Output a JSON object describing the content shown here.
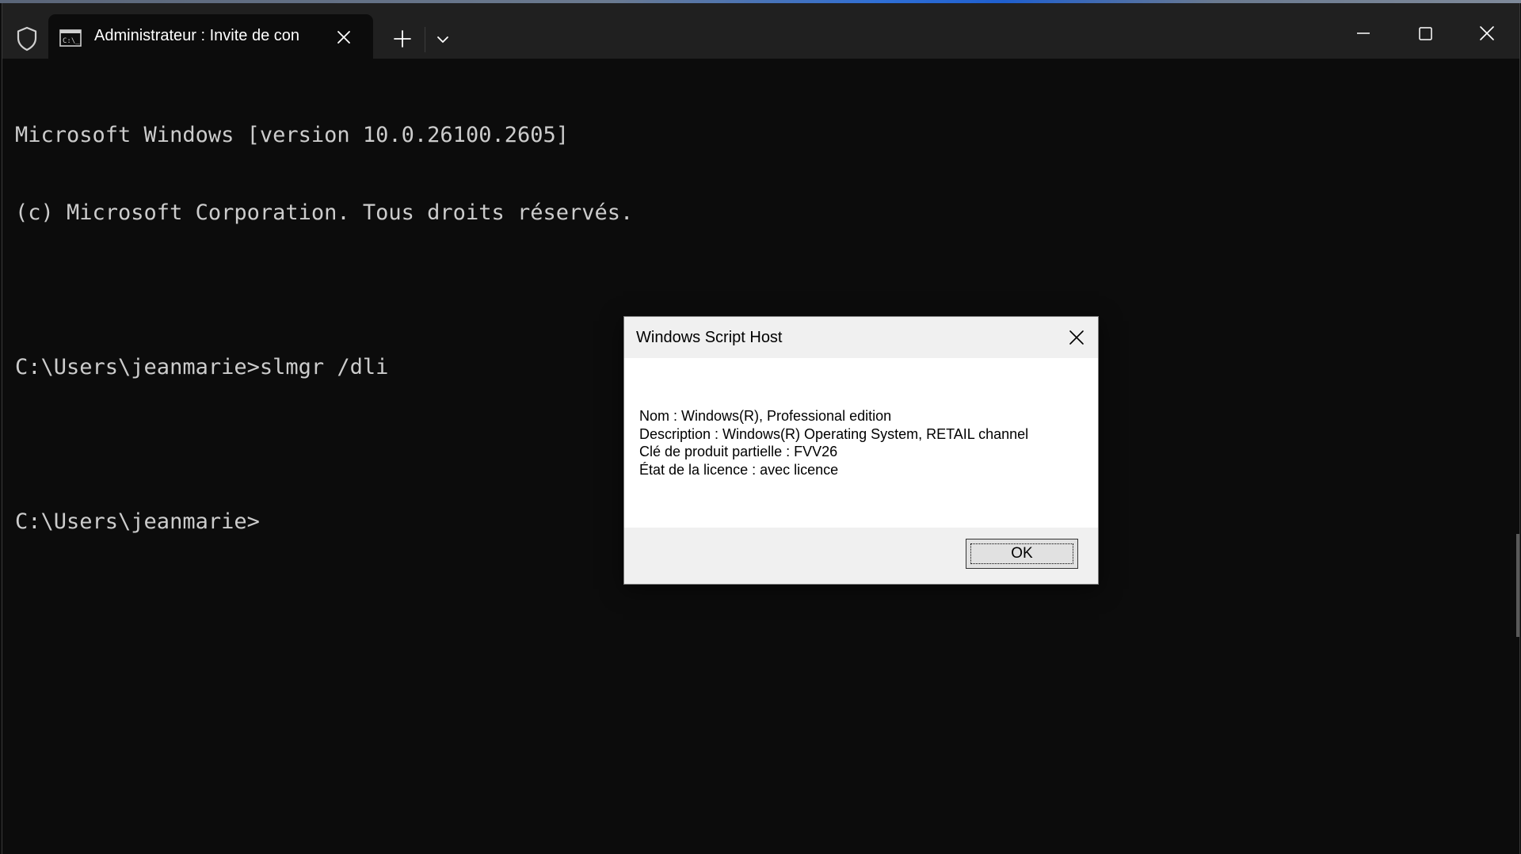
{
  "window": {
    "tab_title": "Administrateur : Invite de con",
    "tab_icon": "cmd-icon",
    "controls": {
      "minimize": "minimize-icon",
      "maximize": "maximize-icon",
      "close": "close-icon"
    }
  },
  "console": {
    "lines": [
      "Microsoft Windows [version 10.0.26100.2605]",
      "(c) Microsoft Corporation. Tous droits réservés.",
      "",
      "C:\\Users\\jeanmarie>slmgr /dli",
      "",
      "C:\\Users\\jeanmarie>"
    ]
  },
  "dialog": {
    "title": "Windows Script Host",
    "lines": [
      "Nom : Windows(R), Professional edition",
      "Description : Windows(R) Operating System, RETAIL channel",
      "Clé de produit partielle : FVV26",
      "État de la licence : avec licence"
    ],
    "ok_label": "OK"
  },
  "colors": {
    "terminal_bg": "#0c0c0c",
    "terminal_text": "#cccccc",
    "titlebar_bg": "#202020",
    "dialog_bg": "#ffffff",
    "dialog_chrome": "#f0f0f0"
  }
}
